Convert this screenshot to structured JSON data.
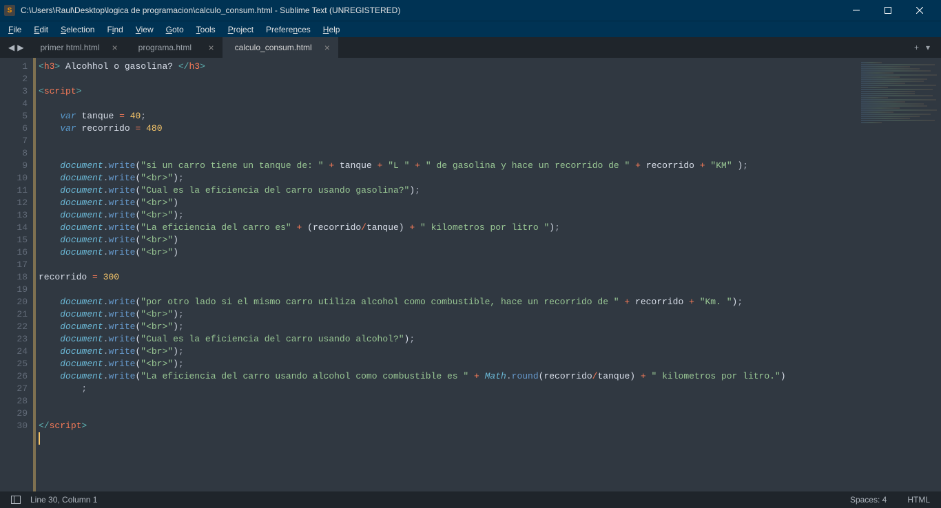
{
  "titlebar": {
    "title": "C:\\Users\\Raul\\Desktop\\logica de programacion\\calculo_consum.html - Sublime Text (UNREGISTERED)"
  },
  "menubar": {
    "items": [
      "File",
      "Edit",
      "Selection",
      "Find",
      "View",
      "Goto",
      "Tools",
      "Project",
      "Preferences",
      "Help"
    ]
  },
  "tabs": [
    {
      "label": "primer html.html",
      "active": false
    },
    {
      "label": "programa.html",
      "active": false
    },
    {
      "label": "calculo_consum.html",
      "active": true
    }
  ],
  "statusbar": {
    "position": "Line 30, Column 1",
    "spaces": "Spaces: 4",
    "syntax": "HTML"
  },
  "code": {
    "lines": 30
  }
}
